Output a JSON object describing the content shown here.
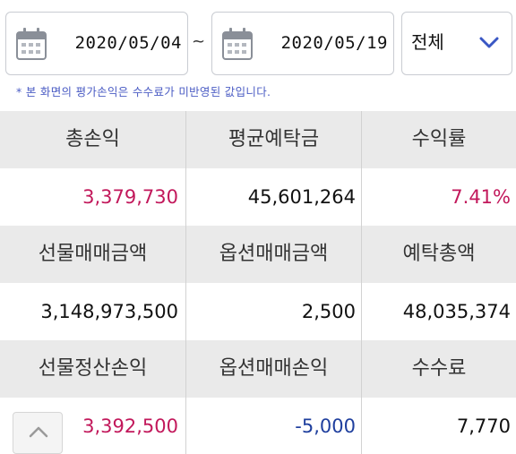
{
  "filter": {
    "date_from": "2020/05/04",
    "separator": "~",
    "date_to": "2020/05/19",
    "type_select": "전체",
    "notice": "* 본 화면의 평가손익은 수수료가 미반영된 값입니다."
  },
  "summary": {
    "rows": [
      {
        "headers": [
          "총손익",
          "평균예탁금",
          "수익률"
        ],
        "values": [
          "3,379,730",
          "45,601,264",
          "7.41%"
        ]
      },
      {
        "headers": [
          "선물매매금액",
          "옵션매매금액",
          "예탁총액"
        ],
        "values": [
          "3,148,973,500",
          "2,500",
          "48,035,374"
        ]
      },
      {
        "headers": [
          "선물정산손익",
          "옵션매매손익",
          "수수료"
        ],
        "values": [
          "3,392,500",
          "-5,000",
          "7,770"
        ]
      }
    ]
  },
  "colors": {
    "positive": "#c2185b",
    "negative": "#1f3f9e",
    "header_bg": "#eaeaea",
    "notice": "#4b5cc4",
    "accent": "#3a57c4"
  },
  "icons": {
    "calendar": "calendar-icon",
    "dropdown": "chevron-down-icon",
    "scroll_top": "chevron-up-icon"
  }
}
